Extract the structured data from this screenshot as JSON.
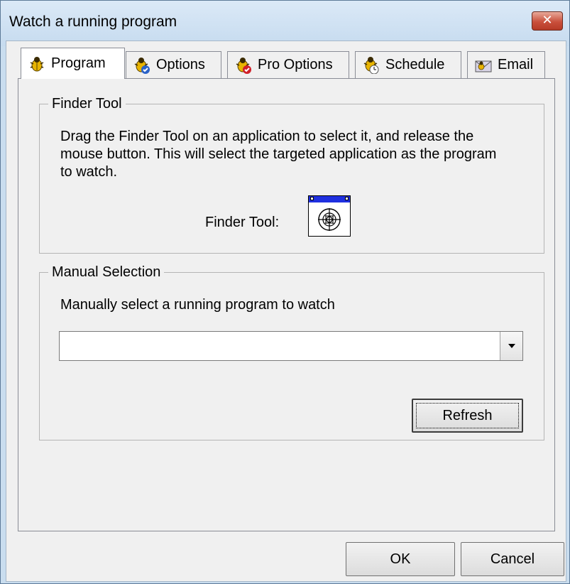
{
  "window": {
    "title": "Watch a running program",
    "close_label": "✕"
  },
  "tabs": [
    {
      "label": "Program",
      "icon": "bug-icon",
      "active": true
    },
    {
      "label": "Options",
      "icon": "bug-check-icon",
      "active": false
    },
    {
      "label": "Pro Options",
      "icon": "bug-red-icon",
      "active": false
    },
    {
      "label": "Schedule",
      "icon": "bug-clock-icon",
      "active": false
    },
    {
      "label": "Email",
      "icon": "email-icon",
      "active": false
    }
  ],
  "finder_group": {
    "title": "Finder Tool",
    "description_lines": [
      "Drag the Finder Tool on an application to select it, and release the",
      "mouse button. This will select the targeted application as the program",
      "to watch."
    ],
    "finder_label": "Finder Tool:",
    "finder_icon": "crosshair-icon"
  },
  "manual_group": {
    "title": "Manual Selection",
    "description": "Manually select a running program to watch",
    "combo_value": "",
    "refresh_label": "Refresh"
  },
  "footer": {
    "ok_label": "OK",
    "cancel_label": "Cancel"
  },
  "colors": {
    "title_bar": "#c6dbef",
    "close_button": "#c9503c",
    "finder_bar": "#1f30e0"
  }
}
